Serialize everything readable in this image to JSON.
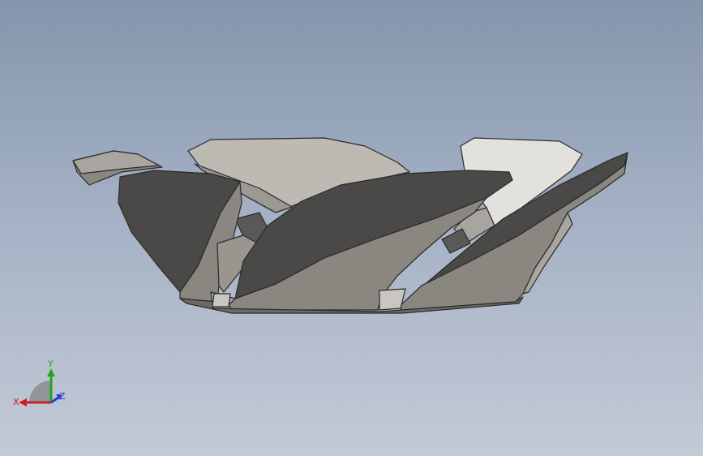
{
  "viewport": {
    "background_top": "#8595ab",
    "background_bottom": "#c3cad7"
  },
  "model": {
    "icon": "sheet-metal-blade-assembly",
    "colors": {
      "dark_face": "#4a4948",
      "mid_face": "#8a8680",
      "light_face": "#bdb9b3",
      "highlight_face": "#e3e1de",
      "edge": "#2a2a2a"
    }
  },
  "triad": {
    "x_label": "X",
    "y_label": "Y",
    "z_label": "Z",
    "x_color": "#cc1f1f",
    "y_color": "#1fa81f",
    "z_color": "#2b3fd0"
  }
}
